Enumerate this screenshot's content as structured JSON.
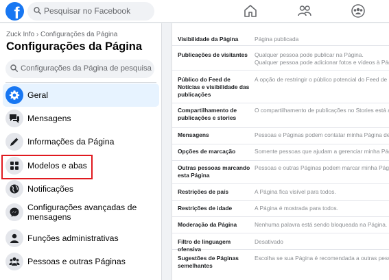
{
  "topbar": {
    "logo_letter": "f",
    "search_placeholder": "Pesquisar no Facebook",
    "icons": [
      "facebook-logo",
      "search-icon",
      "home-icon",
      "friends-icon",
      "groups-icon"
    ]
  },
  "sidebar": {
    "breadcrumb": "Zuck Info › Configurações da Página",
    "title": "Configurações da Página",
    "search_placeholder": "Configurações da Página de pesquisa",
    "items": [
      {
        "label": "Geral",
        "icon": "gear-icon",
        "active": true
      },
      {
        "label": "Mensagens",
        "icon": "chat-bubbles-icon"
      },
      {
        "label": "Informações da Página",
        "icon": "pencil-icon"
      },
      {
        "label": "Modelos e abas",
        "icon": "grid-icon",
        "highlighted": true
      },
      {
        "label": "Notificações",
        "icon": "globe-icon"
      },
      {
        "label": "Configurações avançadas de mensagens",
        "icon": "messenger-icon"
      },
      {
        "label": "Funções administrativas",
        "icon": "person-icon"
      },
      {
        "label": "Pessoas e outras Páginas",
        "icon": "people-icon"
      }
    ],
    "colors": {
      "active_bg": "#e7f3ff",
      "active_icon_bg": "#1877f2",
      "highlight_border": "#e0191f"
    }
  },
  "settings": [
    {
      "label": "Visibilidade da Página",
      "value": "Página publicada"
    },
    {
      "label": "Publicações de visitantes",
      "value": "Qualquer pessoa pode publicar na Página.",
      "value2": "Qualquer pessoa pode adicionar fotos e vídeos à Página"
    },
    {
      "label": "Público do Feed de Notícias e visibilidade das publicações",
      "value": "A opção de restringir o público potencial do Feed de Notícias"
    },
    {
      "label": "Compartilhamento de publicações e stories",
      "value": "O compartilhamento de publicações no Stories está ativado"
    },
    {
      "label": "Mensagens",
      "value": "Pessoas e Páginas podem contatar minha Página de forma privada"
    },
    {
      "label": "Opções de marcação",
      "value": "Somente pessoas que ajudam a gerenciar minha Página podem"
    },
    {
      "label": "Outras pessoas marcando esta Página",
      "value": "Pessoas e outras Páginas podem marcar minha Página"
    },
    {
      "label": "Restrições de país",
      "value": "A Página fica visível para todos."
    },
    {
      "label": "Restrições de idade",
      "value": "A Página é mostrada para todos."
    },
    {
      "label": "Moderação da Página",
      "value": "Nenhuma palavra está sendo bloqueada na Página."
    },
    {
      "label": "Filtro de linguagem ofensiva",
      "value": "Desativado"
    },
    {
      "label": "Sugestões de Páginas semelhantes",
      "value": "Escolha se sua Página é recomendada a outras pessoas"
    }
  ]
}
